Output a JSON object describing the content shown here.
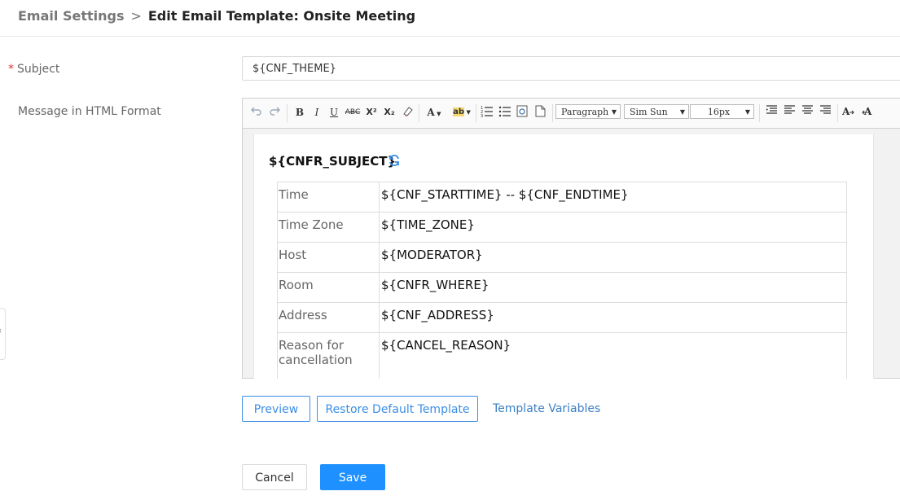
{
  "breadcrumb": {
    "parent": "Email Settings",
    "separator": ">",
    "current": "Edit Email Template: Onsite Meeting"
  },
  "form": {
    "subject_required_mark": "*",
    "subject_label": "Subject",
    "subject_value": "${CNF_THEME}",
    "message_label": "Message in HTML Format"
  },
  "toolbar": {
    "undo_icon": "undo-icon",
    "redo_icon": "redo-icon",
    "bold": "B",
    "italic": "I",
    "underline": "U",
    "strikethrough": "ABC",
    "superscript": "X²",
    "subscript": "X₂",
    "eraser_icon": "eraser-icon",
    "font_color": "A",
    "highlight": "ab",
    "paragraph": "Paragraph",
    "font_family": "Sim Sun",
    "font_size": "16px"
  },
  "document": {
    "title": "${CNFR_SUBJECT}",
    "rows": [
      {
        "key": "Time",
        "value": "${CNF_STARTTIME} -- ${CNF_ENDTIME}"
      },
      {
        "key": "Time Zone",
        "value": "${TIME_ZONE}"
      },
      {
        "key": "Host",
        "value": "${MODERATOR}"
      },
      {
        "key": "Room",
        "value": "${CNFR_WHERE}"
      },
      {
        "key": "Address",
        "value": "${CNF_ADDRESS}"
      },
      {
        "key": "Reason for cancellation",
        "value": "${CANCEL_REASON}"
      }
    ]
  },
  "actions": {
    "preview": "Preview",
    "restore": "Restore Default Template",
    "variables": "Template Variables",
    "cancel": "Cancel",
    "save": "Save"
  },
  "colors": {
    "primary": "#1e90ff",
    "link": "#3a7fc4",
    "required": "#e0322f"
  }
}
